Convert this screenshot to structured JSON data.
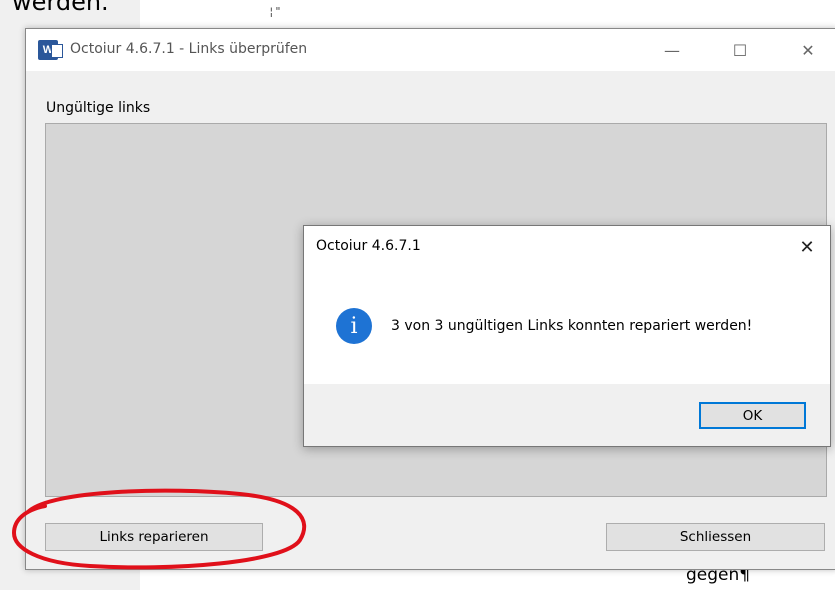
{
  "background_doc": {
    "top_text": "werden.",
    "cursor_mark": "¦\"",
    "bottom_text": "gegen¶"
  },
  "window": {
    "title": "Octoiur 4.6.7.1 - Links überprüfen",
    "app_icon_letter": "W",
    "minimize_glyph": "—",
    "maximize_glyph": "☐",
    "close_glyph": "✕",
    "list_label": "Ungültige links",
    "repair_button": "Links reparieren",
    "close_button": "Schliessen"
  },
  "dialog": {
    "title": "Octoiur 4.6.7.1",
    "close_glyph": "✕",
    "info_glyph": "i",
    "message": "3 von 3 ungültigen Links konnten repariert werden!",
    "ok_button": "OK"
  },
  "colors": {
    "accent": "#0078d7",
    "info_icon": "#1e73d4",
    "annotation": "#e0101a",
    "word_icon": "#2b579a"
  }
}
